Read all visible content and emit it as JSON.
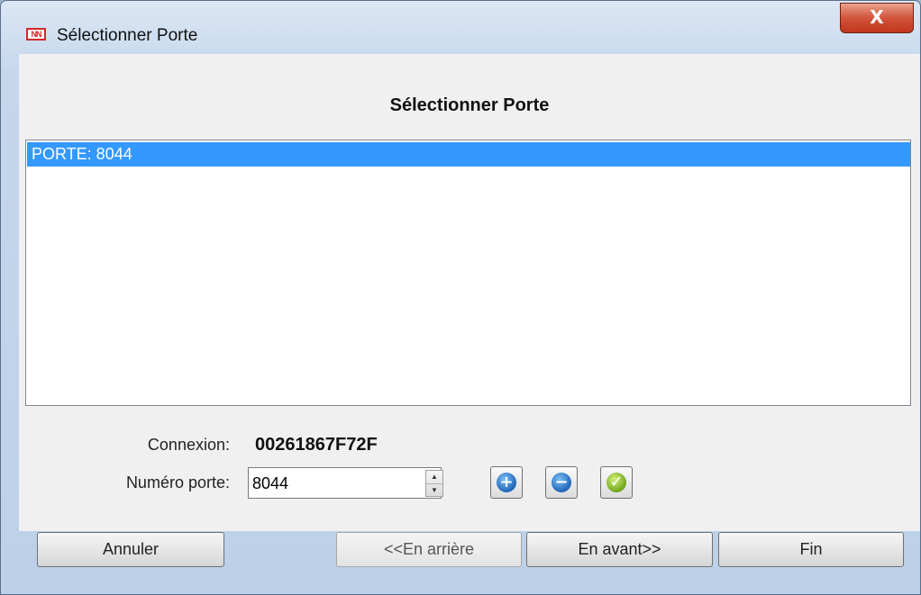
{
  "window": {
    "title": "Sélectionner Porte",
    "app_icon_text": "NN",
    "close_glyph": "X"
  },
  "main": {
    "heading": "Sélectionner Porte",
    "list_items": [
      "PORTE: 8044"
    ],
    "connection_label": "Connexion:",
    "connection_value": "00261867F72F",
    "port_label": "Numéro porte:",
    "port_value": "8044",
    "add_glyph": "+",
    "remove_glyph": "−",
    "confirm_glyph": "✓",
    "spinner_up": "▲",
    "spinner_down": "▼"
  },
  "footer": {
    "cancel": "Annuler",
    "back": "<<En arrière",
    "next": "En avant>>",
    "finish": "Fin"
  },
  "colors": {
    "selection": "#3399ff",
    "close_button": "#c1361e"
  }
}
